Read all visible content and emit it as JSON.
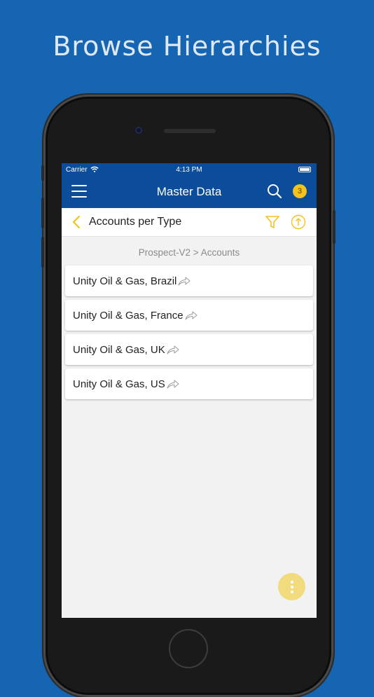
{
  "promo": {
    "title": "Browse Hierarchies"
  },
  "status_bar": {
    "carrier": "Carrier",
    "time": "4:13 PM"
  },
  "nav": {
    "title": "Master Data",
    "notification_count": "3"
  },
  "subheader": {
    "title": "Accounts per Type"
  },
  "breadcrumb": "Prospect-V2 > Accounts",
  "accounts": [
    {
      "label": "Unity Oil & Gas, Brazil"
    },
    {
      "label": "Unity Oil & Gas, France"
    },
    {
      "label": "Unity Oil & Gas, UK"
    },
    {
      "label": "Unity Oil & Gas, US"
    }
  ],
  "colors": {
    "background": "#1565b3",
    "navbar": "#0b4c9b",
    "accent": "#f3c21b",
    "fab": "#f1db7c"
  },
  "icons": {
    "menu": "hamburger-menu-icon",
    "search": "search-icon",
    "back": "chevron-left-icon",
    "filter": "filter-icon",
    "upload": "upload-circle-icon",
    "share": "share-arrow-icon",
    "more": "more-vertical-icon"
  }
}
